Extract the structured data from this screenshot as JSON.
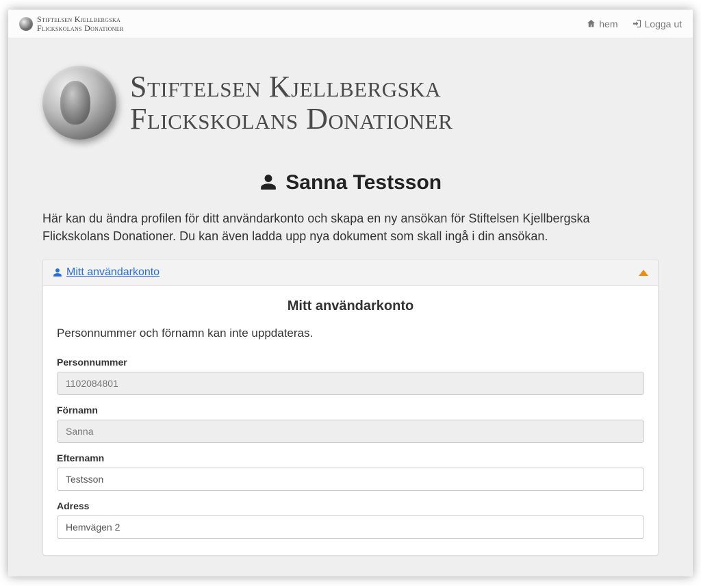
{
  "topbar": {
    "brand_line1": "Stiftelsen Kjellbergska",
    "brand_line2": "Flickskolans Donationer",
    "home_label": "hem",
    "logout_label": "Logga ut"
  },
  "brand": {
    "line1": "Stiftelsen Kjellbergska",
    "line2": "Flickskolans Donationer"
  },
  "page_title": "Sanna Testsson",
  "intro": "Här kan du ändra profilen för ditt användarkonto och skapa en ny ansökan för Stiftelsen Kjellbergska Flickskolans Donationer. Du kan även ladda upp nya dokument som skall ingå i din ansökan.",
  "panel": {
    "head_link": " Mitt användarkonto",
    "heading": "Mitt användarkonto",
    "note": "Personnummer och förnamn kan inte uppdateras.",
    "fields": {
      "personnummer": {
        "label": "Personnummer",
        "value": "1102084801"
      },
      "fornamn": {
        "label": "Förnamn",
        "value": "Sanna"
      },
      "efternamn": {
        "label": "Efternamn",
        "value": "Testsson"
      },
      "adress": {
        "label": "Adress",
        "value": "Hemvägen 2"
      }
    }
  }
}
